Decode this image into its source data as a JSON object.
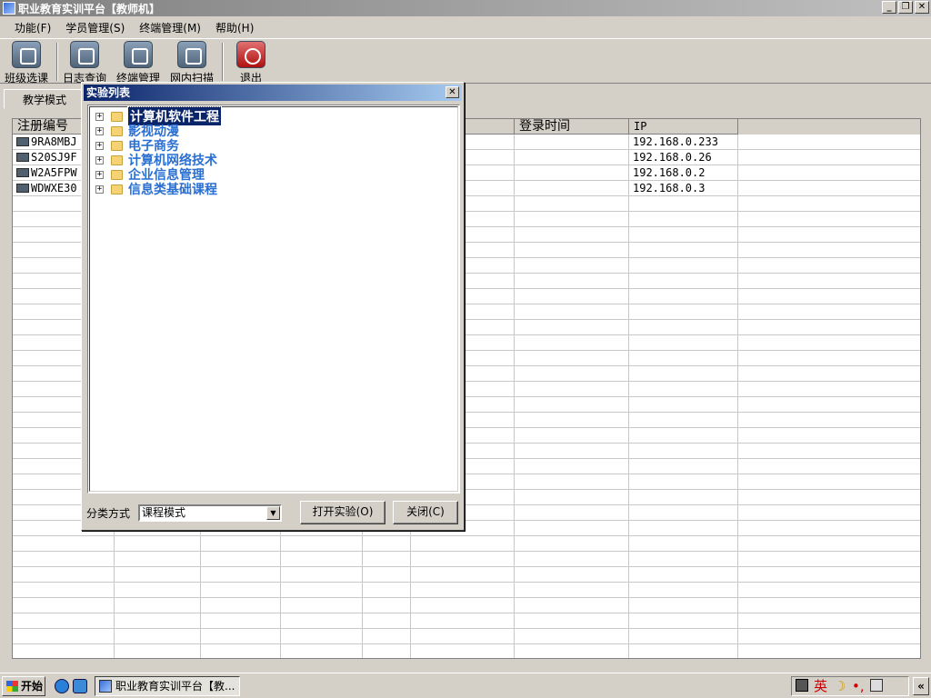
{
  "window": {
    "title": "职业教育实训平台【教师机】"
  },
  "menu": [
    "功能(F)",
    "学员管理(S)",
    "终端管理(M)",
    "帮助(H)"
  ],
  "toolbar": [
    {
      "label": "班级选课",
      "icon": "class-select-icon"
    },
    {
      "label": "日志查询",
      "icon": "log-query-icon"
    },
    {
      "label": "终端管理",
      "icon": "terminal-manage-icon"
    },
    {
      "label": "网内扫描",
      "icon": "network-scan-icon"
    },
    {
      "label": "退出",
      "icon": "exit-icon"
    }
  ],
  "tabs": [
    "教学模式"
  ],
  "grid": {
    "columns": [
      "注册编号",
      "",
      "",
      "",
      "",
      "",
      "登录时间",
      "IP"
    ],
    "rows": [
      {
        "id": "9RA8MBJ",
        "ip": "192.168.0.233"
      },
      {
        "id": "S20SJ9F",
        "ip": "192.168.0.26"
      },
      {
        "id": "W2A5FPW",
        "ip": "192.168.0.2"
      },
      {
        "id": "WDWXE30",
        "ip": "192.168.0.3"
      }
    ]
  },
  "dialog": {
    "title": "实验列表",
    "close_glyph": "✕",
    "tree": [
      {
        "label": "计算机软件工程",
        "selected": true
      },
      {
        "label": "影视动漫",
        "selected": false
      },
      {
        "label": "电子商务",
        "selected": false
      },
      {
        "label": "计算机网络技术",
        "selected": false
      },
      {
        "label": "企业信息管理",
        "selected": false
      },
      {
        "label": "信息类基础课程",
        "selected": false
      }
    ],
    "category_label": "分类方式",
    "category_value": "课程模式",
    "open_button": "打开实验(O)",
    "close_button": "关闭(C)"
  },
  "taskbar": {
    "start": "开始",
    "task": "职业教育实训平台【教...",
    "ime": "英",
    "expand": "«"
  }
}
